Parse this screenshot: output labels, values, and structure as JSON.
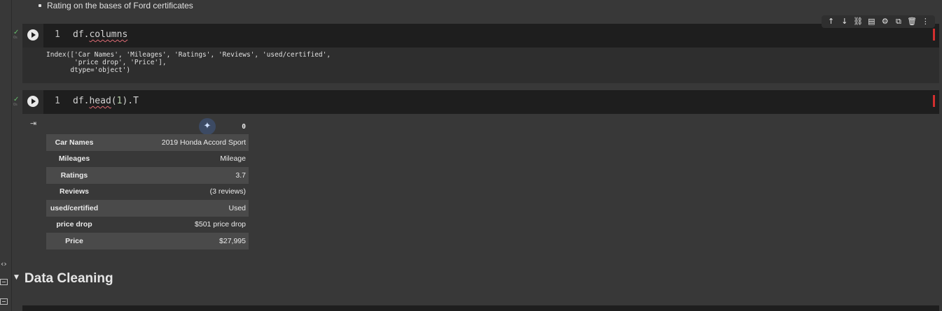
{
  "markdown": {
    "bullet_text": "Rating on the bases of Ford certificates"
  },
  "toolbar": {
    "items": [
      "↑",
      "↓",
      "⛓",
      "▤",
      "⚙",
      "⧉",
      "🗑",
      "⋮"
    ],
    "icon_names": [
      "move-up",
      "move-down",
      "link",
      "comment",
      "settings",
      "mirror",
      "delete",
      "more"
    ]
  },
  "cells": [
    {
      "line_number": "1",
      "code": "df.columns",
      "output": "Index(['Car Names', 'Mileages', 'Ratings', 'Reviews', 'used/certified',\n       'price drop', 'Price'],\n      dtype='object')"
    },
    {
      "line_number": "1",
      "code_obj": "df",
      "code_fn": "head",
      "code_arg": "1",
      "code_tail": ".T",
      "output_table": {
        "column_header": "0",
        "rows": [
          {
            "label": "Car Names",
            "value": "2019 Honda Accord Sport"
          },
          {
            "label": "Mileages",
            "value": "Mileage"
          },
          {
            "label": "Ratings",
            "value": "3.7"
          },
          {
            "label": "Reviews",
            "value": "(3 reviews)"
          },
          {
            "label": "used/certified",
            "value": "Used"
          },
          {
            "label": "price drop",
            "value": "$501 price drop"
          },
          {
            "label": "Price",
            "value": "$27,995"
          }
        ]
      }
    }
  ],
  "section": {
    "title": "Data Cleaning"
  },
  "colors": {
    "background": "#383838",
    "code_bg": "#1e1e1e",
    "status_green": "#66bb6a",
    "error_mark": "#d32f2f"
  }
}
